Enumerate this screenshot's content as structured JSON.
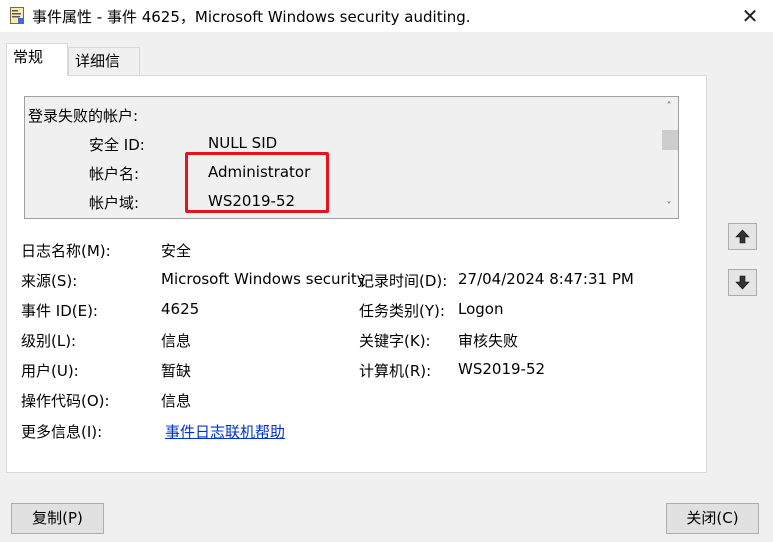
{
  "window": {
    "title": "事件属性 - 事件 4625，Microsoft Windows security auditing.",
    "close_glyph": "✕"
  },
  "tabs": [
    "常规",
    "详细信息"
  ],
  "description": {
    "heading": "登录失败的帐户:",
    "rows": [
      {
        "label": "安全 ID:",
        "value": "NULL SID"
      },
      {
        "label": "帐户名:",
        "value": "Administrator"
      },
      {
        "label": "帐户域:",
        "value": "WS2019-52"
      }
    ],
    "scroll_up": "˄",
    "scroll_down": "˅",
    "highlight_color": "#e8121b"
  },
  "fields": {
    "log_name": {
      "label": "日志名称(M):",
      "value": "安全"
    },
    "source": {
      "label": "来源(S):",
      "value": "Microsoft Windows security"
    },
    "logged": {
      "label": "记录时间(D):",
      "value": "27/04/2024 8:47:31 PM"
    },
    "event_id": {
      "label": "事件 ID(E):",
      "value": "4625"
    },
    "task_category": {
      "label": "任务类别(Y):",
      "value": "Logon"
    },
    "level": {
      "label": "级别(L):",
      "value": "信息"
    },
    "keywords": {
      "label": "关键字(K):",
      "value": "审核失败"
    },
    "user": {
      "label": "用户(U):",
      "value": "暂缺"
    },
    "computer": {
      "label": "计算机(R):",
      "value": "WS2019-52"
    },
    "opcode": {
      "label": "操作代码(O):",
      "value": "信息"
    },
    "more_info": {
      "label": "更多信息(I):",
      "value": "事件日志联机帮助"
    }
  },
  "buttons": {
    "copy": "复制(P)",
    "close": "关闭(C)",
    "prev_icon": "arrow-up-icon",
    "next_icon": "arrow-down-icon"
  },
  "colors": {
    "link": "#0033cc",
    "background": "#f0f0f0"
  }
}
